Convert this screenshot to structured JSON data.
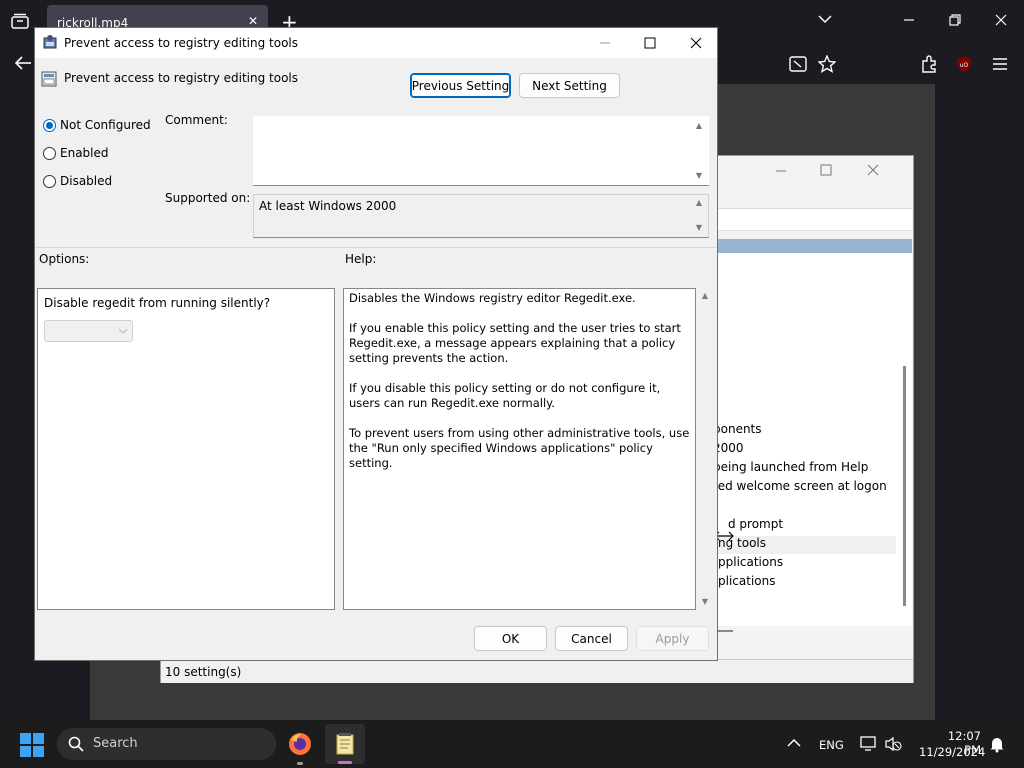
{
  "browser": {
    "tab_title": "rickroll.mp4",
    "tab_close": "✕",
    "new_tab": "+"
  },
  "bg_window": {
    "list_items": [
      "ponents",
      "2000",
      "being launched from Help",
      "ted welcome screen at logon",
      "",
      "d prompt",
      "ng tools",
      "pplications",
      "plications"
    ],
    "status": "10 setting(s)"
  },
  "dialog": {
    "title": "Prevent access to registry editing tools",
    "setting_name": "Prevent access to registry editing tools",
    "prev_button": "Previous Setting",
    "next_button": "Next Setting",
    "radios": [
      {
        "label": "Not Configured",
        "selected": true
      },
      {
        "label": "Enabled",
        "selected": false
      },
      {
        "label": "Disabled",
        "selected": false
      }
    ],
    "comment_label": "Comment:",
    "comment_value": "",
    "supported_label": "Supported on:",
    "supported_value": "At least Windows 2000",
    "options_label": "Options:",
    "help_label": "Help:",
    "option_question": "Disable regedit from running silently?",
    "option_dropdown_value": "",
    "help_paragraphs": [
      "Disables the Windows registry editor Regedit.exe.",
      "If you enable this policy setting and the user tries to start Regedit.exe, a message appears explaining that a policy setting prevents the action.",
      "If you disable this policy setting or do not configure it, users can run Regedit.exe normally.",
      "To prevent users from using other administrative tools, use the \"Run only specified Windows applications\" policy setting."
    ],
    "ok_button": "OK",
    "cancel_button": "Cancel",
    "apply_button": "Apply"
  },
  "taskbar": {
    "search_label": "Search",
    "language": "ENG",
    "time": "12:07 PM",
    "date": "11/29/2024"
  },
  "colors": {
    "accent": "#0067c0",
    "taskbar": "#1c1c1c",
    "browser": "#1c1b22"
  }
}
